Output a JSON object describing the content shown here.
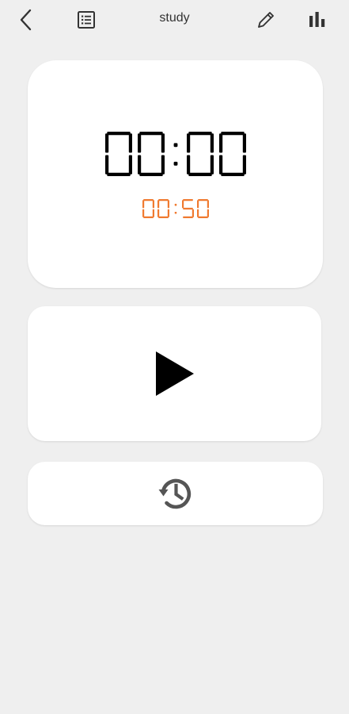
{
  "header": {
    "title": "study",
    "icons": [
      "chevron-left-icon",
      "list-icon",
      "pencil-icon",
      "bar-chart-icon"
    ]
  },
  "timer": {
    "elapsed": "00:00",
    "target": "00:50",
    "elapsed_color": "#000000",
    "target_color": "#f07a30"
  },
  "controls": {
    "play_icon": "play-icon",
    "history_icon": "history-icon"
  }
}
